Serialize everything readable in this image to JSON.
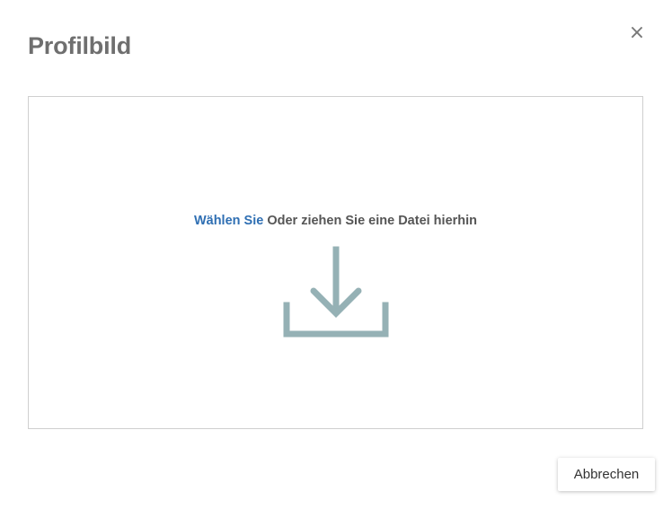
{
  "dialog": {
    "title": "Profilbild",
    "close_label": "×"
  },
  "dropzone": {
    "choose_link": "Wählen Sie",
    "instruction": "Oder ziehen Sie eine Datei hierhin",
    "icon": "download-icon",
    "icon_color": "#95b1b5"
  },
  "footer": {
    "cancel_label": "Abbrechen"
  },
  "colors": {
    "link": "#2f6fb3",
    "title": "#6f6f6f",
    "border": "#cfcfcf"
  }
}
